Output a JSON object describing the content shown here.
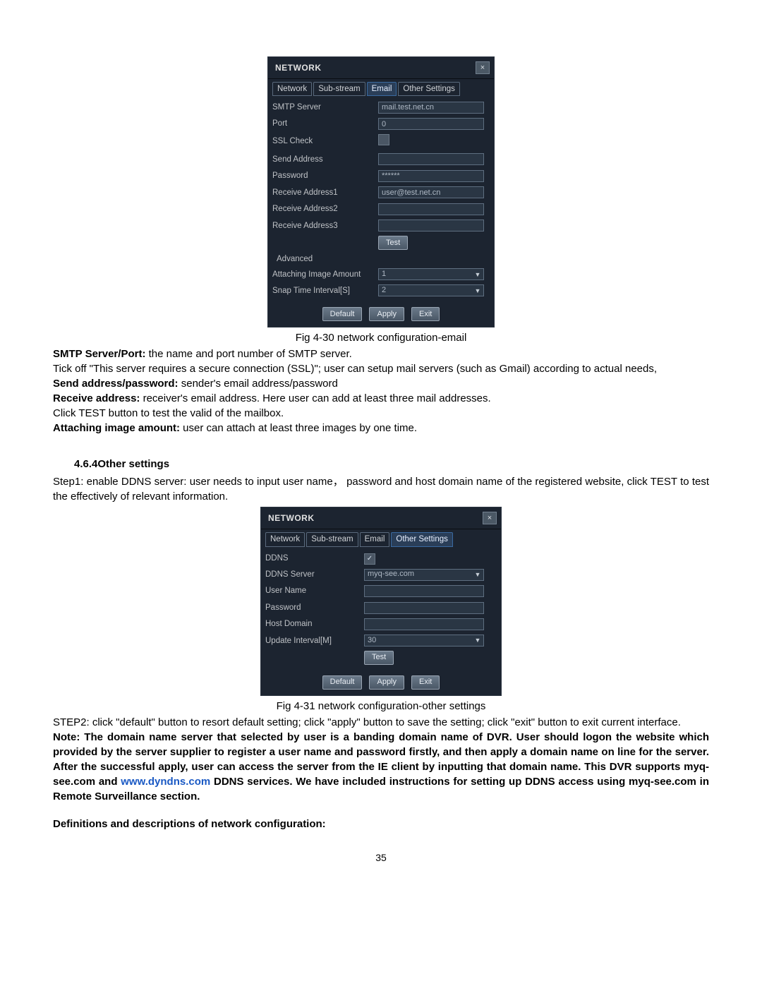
{
  "dialog1": {
    "title": "NETWORK",
    "close": "×",
    "tabs": [
      "Network",
      "Sub-stream",
      "Email",
      "Other Settings"
    ],
    "active_tab": 2,
    "rows": {
      "smtp_label": "SMTP Server",
      "smtp_value": "mail.test.net.cn",
      "port_label": "Port",
      "port_value": "0",
      "ssl_label": "SSL Check",
      "send_label": "Send Address",
      "send_value": "",
      "pass_label": "Password",
      "pass_value": "******",
      "r1_label": "Receive Address1",
      "r1_value": "user@test.net.cn",
      "r2_label": "Receive Address2",
      "r2_value": "",
      "r3_label": "Receive Address3",
      "r3_value": "",
      "test": "Test",
      "advanced": "Advanced",
      "attach_label": "Attaching Image Amount",
      "attach_value": "1",
      "snap_label": "Snap Time Interval[S]",
      "snap_value": "2"
    },
    "footer": {
      "default": "Default",
      "apply": "Apply",
      "exit": "Exit"
    }
  },
  "figcap1": "Fig 4-30 network configuration-email",
  "para1_strong": "SMTP Server/Port:",
  "para1_rest": " the name and port number of SMTP server.",
  "para2": "Tick off \"This server requires a secure connection (SSL)\"; user can setup mail servers (such as Gmail) according to actual needs,",
  "para3_strong": "Send address/password:",
  "para3_rest": " sender's email address/password",
  "para4_strong": "Receive address:",
  "para4_rest": " receiver's email address. Here user can add at least three mail addresses.",
  "para5": "Click TEST button to test the valid of the mailbox.",
  "para6_strong": "Attaching image amount:",
  "para6_rest": " user can attach at least three images by one time.",
  "heading": "4.6.4Other settings",
  "para7": "Step1: enable DDNS server: user needs to input user name， password and host domain name of the registered website, click TEST to test the effectively of relevant information.",
  "dialog2": {
    "title": "NETWORK",
    "close": "×",
    "tabs": [
      "Network",
      "Sub-stream",
      "Email",
      "Other Settings"
    ],
    "active_tab": 3,
    "rows": {
      "ddns_label": "DDNS",
      "ddns_server_label": "DDNS Server",
      "ddns_server_value": "myq-see.com",
      "user_label": "User Name",
      "user_value": "",
      "pass_label": "Password",
      "pass_value": "",
      "host_label": "Host Domain",
      "host_value": "",
      "upd_label": "Update Interval[M]",
      "upd_value": "30",
      "test": "Test"
    },
    "footer": {
      "default": "Default",
      "apply": "Apply",
      "exit": "Exit"
    }
  },
  "figcap2": "Fig 4-31 network configuration-other settings",
  "para8": "STEP2: click \"default\" button to resort default setting; click \"apply\" button to save the setting; click \"exit\" button to exit current interface.",
  "note_pre": "Note: The domain name server that selected by user is a banding domain name of DVR. User should logon the website which provided by the server supplier to register a user name and password firstly, and then apply a domain name on line for the server. After the successful apply, user can access the server from the IE client by inputting that domain name. This DVR supports myq-see.com and ",
  "note_link": "www.dyndns.com",
  "note_post": " DDNS services. We have included instructions for setting up DDNS access using myq-see.com in Remote Surveillance section.",
  "defs_head": "Definitions and descriptions of network configuration:",
  "pagenum": "35"
}
